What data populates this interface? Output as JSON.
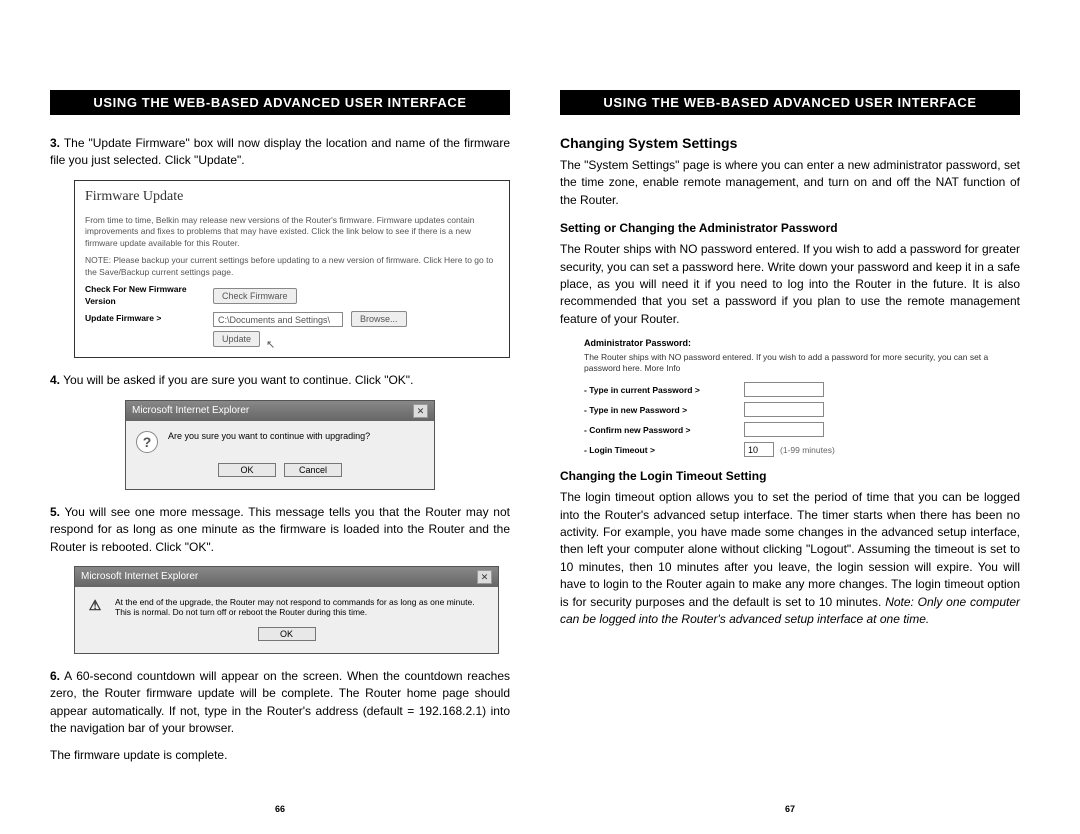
{
  "left": {
    "header": "USING THE WEB-BASED ADVANCED USER INTERFACE",
    "s3_num": "3.",
    "s3": "The \"Update Firmware\" box will now display the location and name of the firmware file you just selected. Click \"Update\".",
    "fwbox": {
      "title": "Firmware Update",
      "p1": "From time to time, Belkin may release new versions of the Router's firmware. Firmware updates contain improvements and fixes to problems that may have existed. Click the link below to see if there is a new firmware update available for this Router.",
      "p2": "NOTE: Please backup your current settings before updating to a new version of firmware. Click Here to go to the Save/Backup current settings page.",
      "row1_lbl": "Check For New Firmware Version",
      "row1_btn": "Check Firmware",
      "row2_lbl": "Update Firmware >",
      "row2_val": "C:\\Documents and Settings\\",
      "row2_browse": "Browse...",
      "row3_btn": "Update"
    },
    "s4_num": "4.",
    "s4": "You will be asked if you are sure you want to continue. Click \"OK\".",
    "dlg1": {
      "title": "Microsoft Internet Explorer",
      "msg": "Are you sure you want to continue with upgrading?",
      "ok": "OK",
      "cancel": "Cancel"
    },
    "s5_num": "5.",
    "s5": "You will see one more message. This message tells you that the Router may not respond for as long as one minute as the firmware is loaded into the Router and the Router is rebooted. Click \"OK\".",
    "dlg2": {
      "title": "Microsoft Internet Explorer",
      "msg": "At the end of the upgrade, the Router may not respond to commands for as long as one minute. This is normal. Do not turn off or reboot the Router during this time.",
      "ok": "OK"
    },
    "s6_num": "6.",
    "s6": "A 60-second countdown will appear on the screen. When the countdown reaches zero, the Router firmware update will be complete. The Router home page should appear automatically. If not, type in the Router's address (default = 192.168.2.1) into the navigation bar of your browser.",
    "done": "The firmware update is complete.",
    "pagenum": "66"
  },
  "right": {
    "header": "USING THE WEB-BASED ADVANCED USER INTERFACE",
    "h3": "Changing System Settings",
    "p1": "The \"System Settings\" page is where you can enter a new administrator password, set the time zone, enable remote management, and turn on and off the NAT function of the Router.",
    "h4a": "Setting or Changing the Administrator Password",
    "p2": "The Router ships with NO password entered. If you wish to add a password for greater security, you can set a password here. Write down your password and keep it in a safe place, as you will need it if you need to log into the Router in the future. It is also recommended that you set a password if you plan to use the remote management feature of your Router.",
    "pwd": {
      "title": "Administrator Password:",
      "desc": "The Router ships with NO password entered. If you wish to add a password for more security, you can set a password here. More Info",
      "r1": "- Type in current Password >",
      "r2": "- Type in new Password >",
      "r3": "- Confirm new Password >",
      "r4": "- Login Timeout >",
      "r4_val": "10",
      "r4_note": "(1-99 minutes)"
    },
    "h4b": "Changing the Login Timeout Setting",
    "p3a": "The login timeout option allows you to set the period of time that you can be logged into the Router's advanced setup interface. The timer starts when there has been no activity. For example, you have made some changes in the advanced setup interface, then left your computer alone without clicking \"Logout\". Assuming the timeout is set to 10 minutes, then 10 minutes after you leave, the login session will expire. You will have to login to the Router again to make any more changes. The login timeout option is for security purposes and the default is set to 10 minutes. ",
    "p3b": "Note: Only one computer can be logged into the Router's advanced setup interface at one time.",
    "pagenum": "67"
  }
}
